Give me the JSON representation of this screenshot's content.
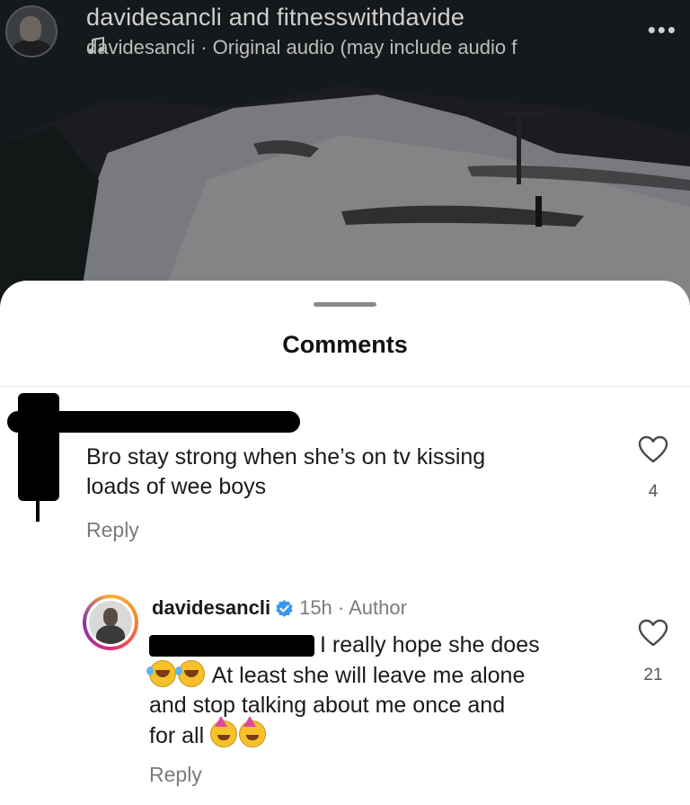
{
  "video": {
    "account_line": "davidesancli and fitnesswithdavide",
    "audio_line": "davidesancli · Original audio (may include audio f",
    "icons": {
      "music": "music-note-icon",
      "more": "more-options-icon"
    }
  },
  "comments_sheet": {
    "title": "Comments",
    "comments": [
      {
        "text_line1": "Bro stay strong when she’s on tv kissing",
        "text_line2": "loads of wee boys",
        "likes": "4",
        "reply_label": "Reply"
      },
      {
        "username": "davidesancli",
        "meta": "15h · Author",
        "text_line1": "I really hope she does",
        "text_line2": "At least she will leave me alone",
        "text_line3": "and stop talking about me once and",
        "text_line4": "for all",
        "likes": "21",
        "reply_label": "Reply",
        "icons": {
          "verified": "verified-badge-icon",
          "emoji_a": "rolling-on-floor-laughing-icon",
          "emoji_b": "partying-face-icon"
        }
      }
    ]
  },
  "colors": {
    "verified_blue": "#3897f0",
    "muted_text": "#7b7b7b",
    "sheet_bg": "#ffffff"
  }
}
